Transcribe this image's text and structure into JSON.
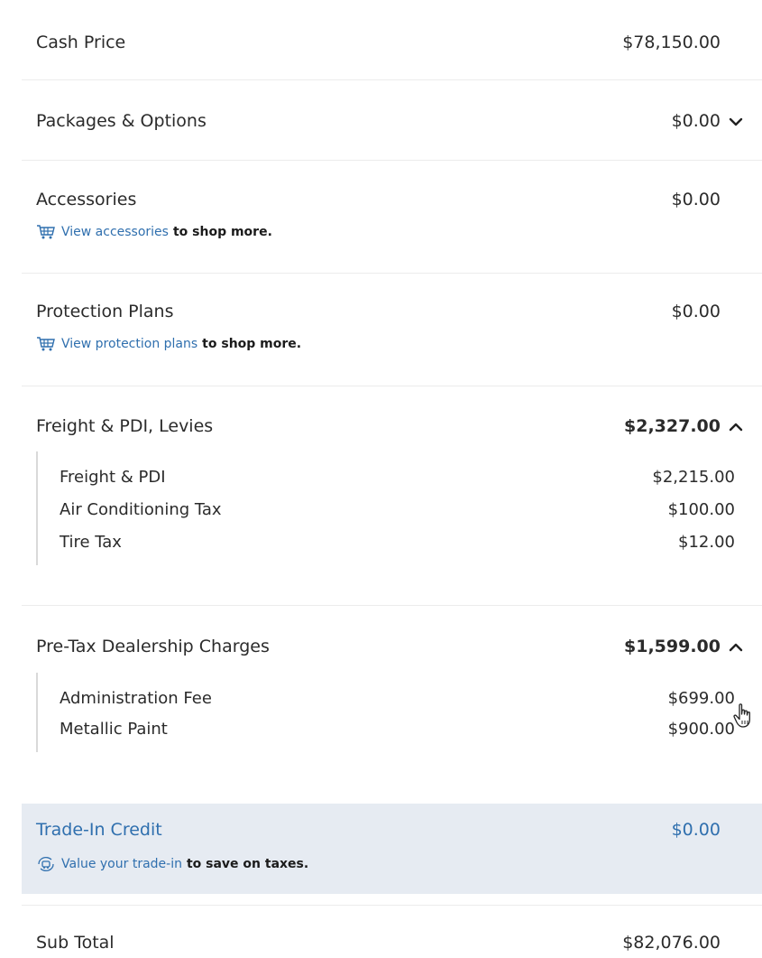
{
  "summary": {
    "cash_price": {
      "label": "Cash Price",
      "amount": "$78,150.00"
    },
    "packages": {
      "label": "Packages & Options",
      "amount": "$0.00"
    },
    "accessories": {
      "label": "Accessories",
      "amount": "$0.00",
      "link": "View accessories",
      "suffix": "to shop more."
    },
    "protection": {
      "label": "Protection Plans",
      "amount": "$0.00",
      "link": "View protection plans",
      "suffix": "to shop more."
    },
    "freight": {
      "label": "Freight & PDI, Levies",
      "amount": "$2,327.00",
      "items": [
        {
          "label": "Freight & PDI",
          "amount": "$2,215.00"
        },
        {
          "label": "Air Conditioning Tax",
          "amount": "$100.00"
        },
        {
          "label": "Tire Tax",
          "amount": "$12.00"
        }
      ]
    },
    "dealer": {
      "label": "Pre-Tax Dealership Charges",
      "amount": "$1,599.00",
      "items": [
        {
          "label": "Administration Fee",
          "amount": "$699.00"
        },
        {
          "label": "Metallic Paint",
          "amount": "$900.00"
        }
      ]
    },
    "trade_in": {
      "label": "Trade-In Credit",
      "amount": "$0.00",
      "link": "Value your trade-in",
      "suffix": "to save on taxes."
    },
    "subtotal": {
      "label": "Sub Total",
      "amount": "$82,076.00"
    }
  },
  "colors": {
    "link": "#2f6fae",
    "trade_bg": "#e6ebf2",
    "divider": "#ececec"
  },
  "icons": {
    "cart": "shopping-cart-icon",
    "trade": "car-trade-icon",
    "chevron_down": "chevron-down-icon",
    "chevron_up": "chevron-up-icon",
    "cursor": "hand-pointer-icon"
  }
}
